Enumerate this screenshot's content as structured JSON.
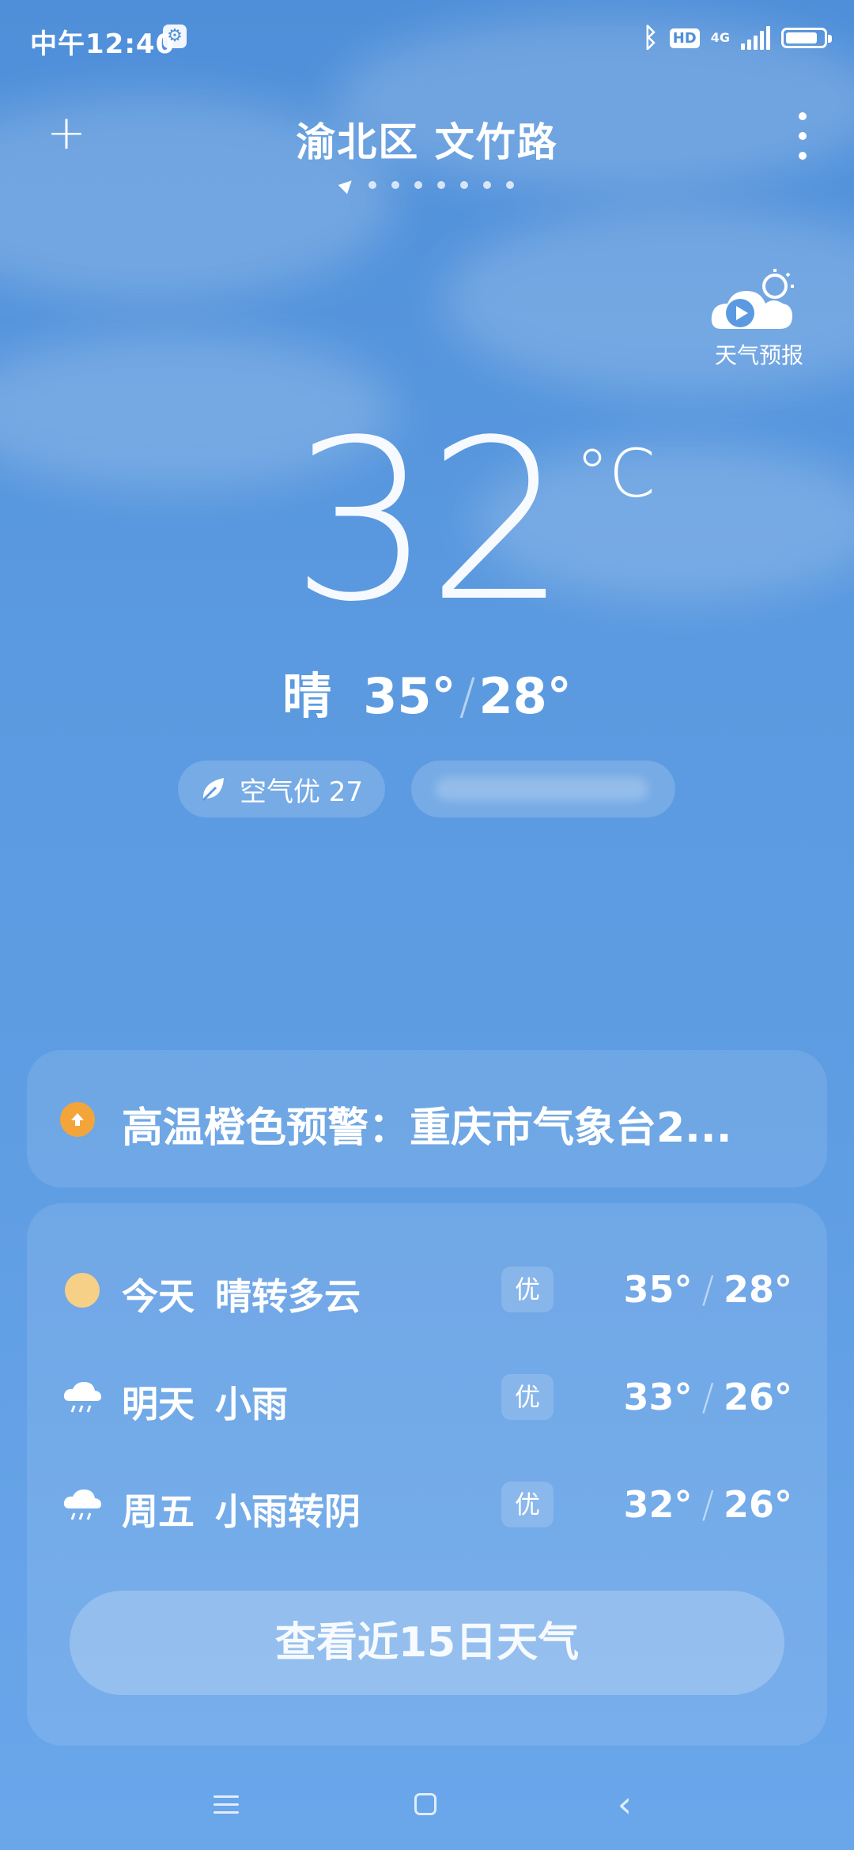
{
  "status_bar": {
    "time": "中午12:40",
    "network": "4G",
    "hd_label": "HD",
    "icons": [
      "settings-icon",
      "bluetooth-icon",
      "hd-icon",
      "signal-icon",
      "battery-icon"
    ],
    "battery_level": 0.85,
    "signal_level": 5
  },
  "header": {
    "location": "渝北区 文竹路",
    "page_count": 8,
    "current_page": 1
  },
  "video_forecast": {
    "label": "天气预报"
  },
  "current": {
    "temperature": "32",
    "unit": "°C",
    "condition": "晴",
    "high": "35°",
    "low": "28°"
  },
  "chips": {
    "air_quality": "空气优 27"
  },
  "warning": {
    "text": "高温橙色预警：重庆市气象台2..."
  },
  "forecast": [
    {
      "day": "今天",
      "condition": "晴转多云",
      "aqi": "优",
      "high": "35°",
      "low": "28°",
      "icon": "sun-icon"
    },
    {
      "day": "明天",
      "condition": "小雨",
      "aqi": "优",
      "high": "33°",
      "low": "26°",
      "icon": "light-rain-icon"
    },
    {
      "day": "周五",
      "condition": "小雨转阴",
      "aqi": "优",
      "high": "32°",
      "low": "26°",
      "icon": "light-rain-icon"
    }
  ],
  "buttons": {
    "fifteen_day": "查看近15日天气"
  },
  "colors": {
    "sky": "#5b9ae0",
    "warning": "#f3a53a",
    "sun": "#f7d087"
  }
}
